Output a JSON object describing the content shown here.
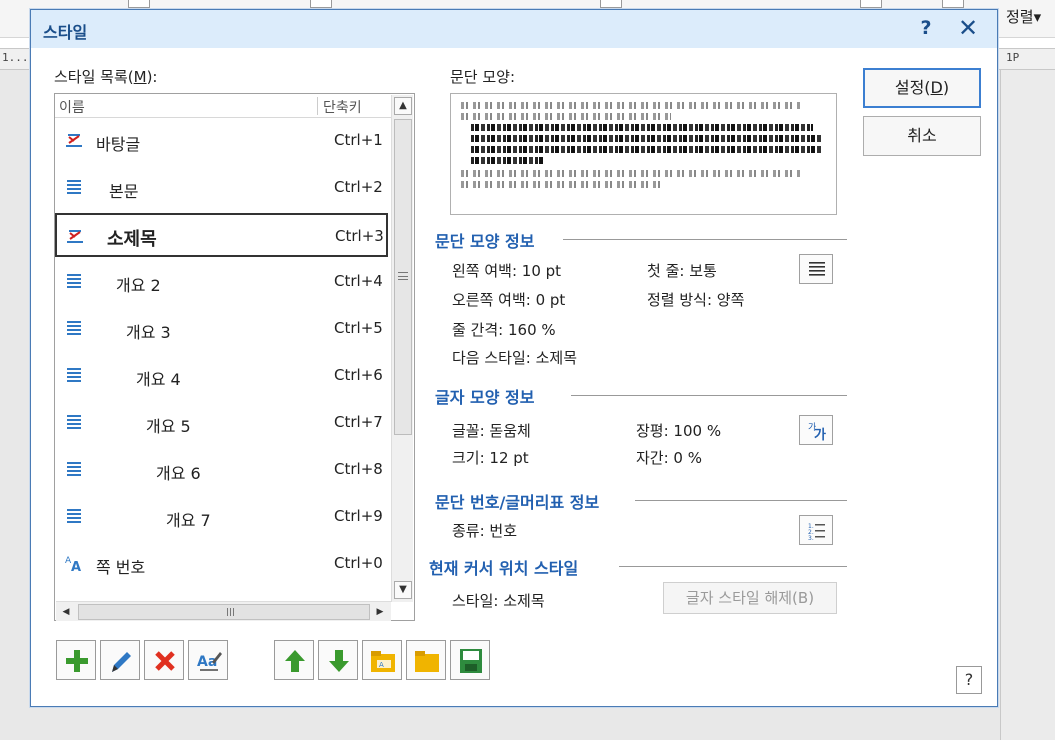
{
  "app": {
    "right_label": "정렬▾",
    "ruler_left": "1...",
    "ruler_right": "1P"
  },
  "dialog": {
    "title": "스타일",
    "help_glyph": "?",
    "close_glyph": "✕",
    "list_label_prefix": "스타일 목록(",
    "list_label_key": "M",
    "list_label_suffix": "):",
    "preview_label": "문단 모양:",
    "list_columns": {
      "name": "이름",
      "shortcut": "단축키"
    },
    "styles": [
      {
        "name": "바탕글",
        "shortcut": "Ctrl+1",
        "icon": "char-style-icon"
      },
      {
        "name": "본문",
        "shortcut": "Ctrl+2",
        "icon": "paragraph-style-icon"
      },
      {
        "name": "소제목",
        "shortcut": "Ctrl+3",
        "icon": "char-style-icon"
      },
      {
        "name": "개요 2",
        "shortcut": "Ctrl+4",
        "icon": "paragraph-style-icon"
      },
      {
        "name": "개요 3",
        "shortcut": "Ctrl+5",
        "icon": "paragraph-style-icon"
      },
      {
        "name": "개요 4",
        "shortcut": "Ctrl+6",
        "icon": "paragraph-style-icon"
      },
      {
        "name": "개요 5",
        "shortcut": "Ctrl+7",
        "icon": "paragraph-style-icon"
      },
      {
        "name": "개요 6",
        "shortcut": "Ctrl+8",
        "icon": "paragraph-style-icon"
      },
      {
        "name": "개요 7",
        "shortcut": "Ctrl+9",
        "icon": "paragraph-style-icon"
      },
      {
        "name": "쪽 번호",
        "shortcut": "Ctrl+0",
        "icon": "letter-style-icon"
      }
    ],
    "selected_style": "소제목",
    "para_info": {
      "heading": "문단 모양 정보",
      "left_margin": "왼쪽 여백:     10 pt",
      "right_margin": "오른쪽 여백: 0 pt",
      "first_line": "첫 줄: 보통",
      "alignment": "정렬 방식: 양쪽",
      "line_spacing": "줄 간격:  160 %",
      "next_style": "다음 스타일: 소제목"
    },
    "char_info": {
      "heading": "글자 모양 정보",
      "font": "글꼴: 돋움체",
      "width_ratio": "장평: 100 %",
      "size": "크기: 12 pt",
      "spacing": "자간: 0 %"
    },
    "numbering_info": {
      "heading": "문단 번호/글머리표 정보",
      "kind": "종류: 번호"
    },
    "cursor_info": {
      "heading": "현재 커서 위치 스타일",
      "style": "스타일: 소제목",
      "clear_button": "글자 스타일 해제(B)"
    },
    "buttons": {
      "ok_prefix": "설정(",
      "ok_key": "D",
      "ok_suffix": ")",
      "cancel": "취소"
    },
    "corner_help": "?",
    "colors": {
      "accent": "#2260b0",
      "title_bg": "#dcecfb",
      "add_green": "#3a9a2e",
      "delete_red": "#e03020",
      "folder_yellow": "#f0b400",
      "save_green": "#2e8b3e"
    }
  }
}
